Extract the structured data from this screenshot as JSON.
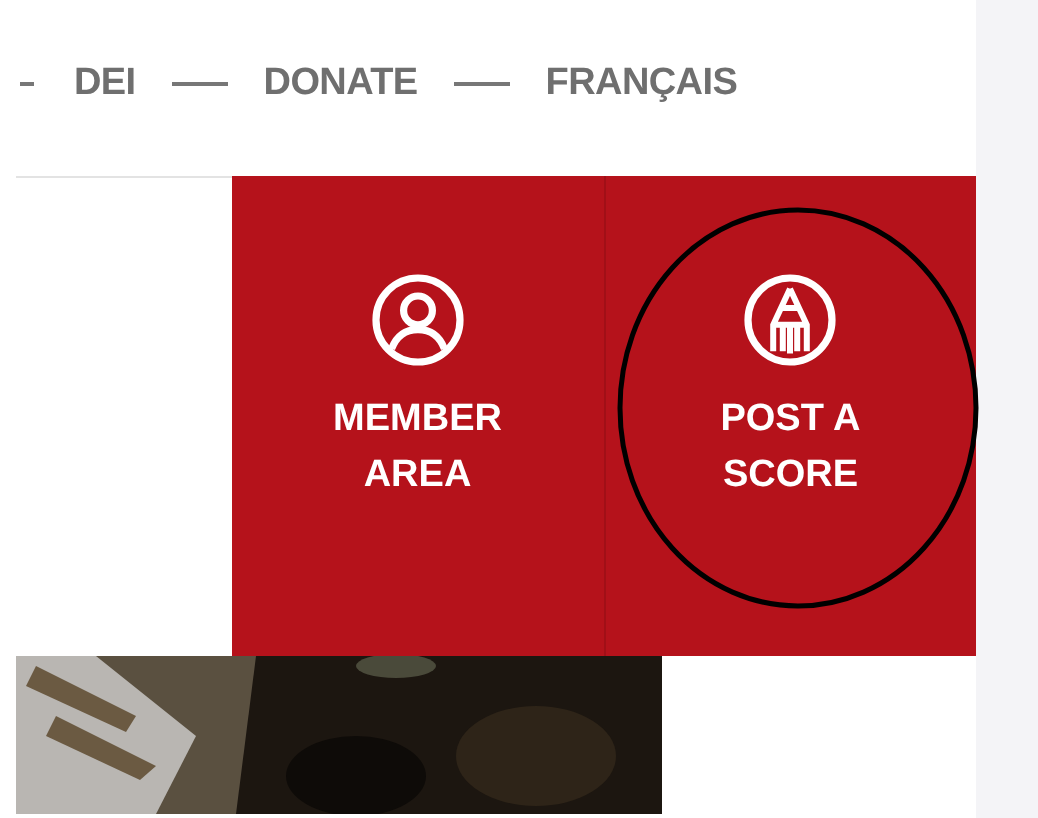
{
  "nav": {
    "links": [
      {
        "label": "DEI"
      },
      {
        "label": "DONATE"
      },
      {
        "label": "FRANÇAIS"
      }
    ]
  },
  "tiles": [
    {
      "kind": "member",
      "label": "MEMBER AREA",
      "circled": false
    },
    {
      "kind": "score",
      "label": "POST A SCORE",
      "circled": true
    }
  ]
}
